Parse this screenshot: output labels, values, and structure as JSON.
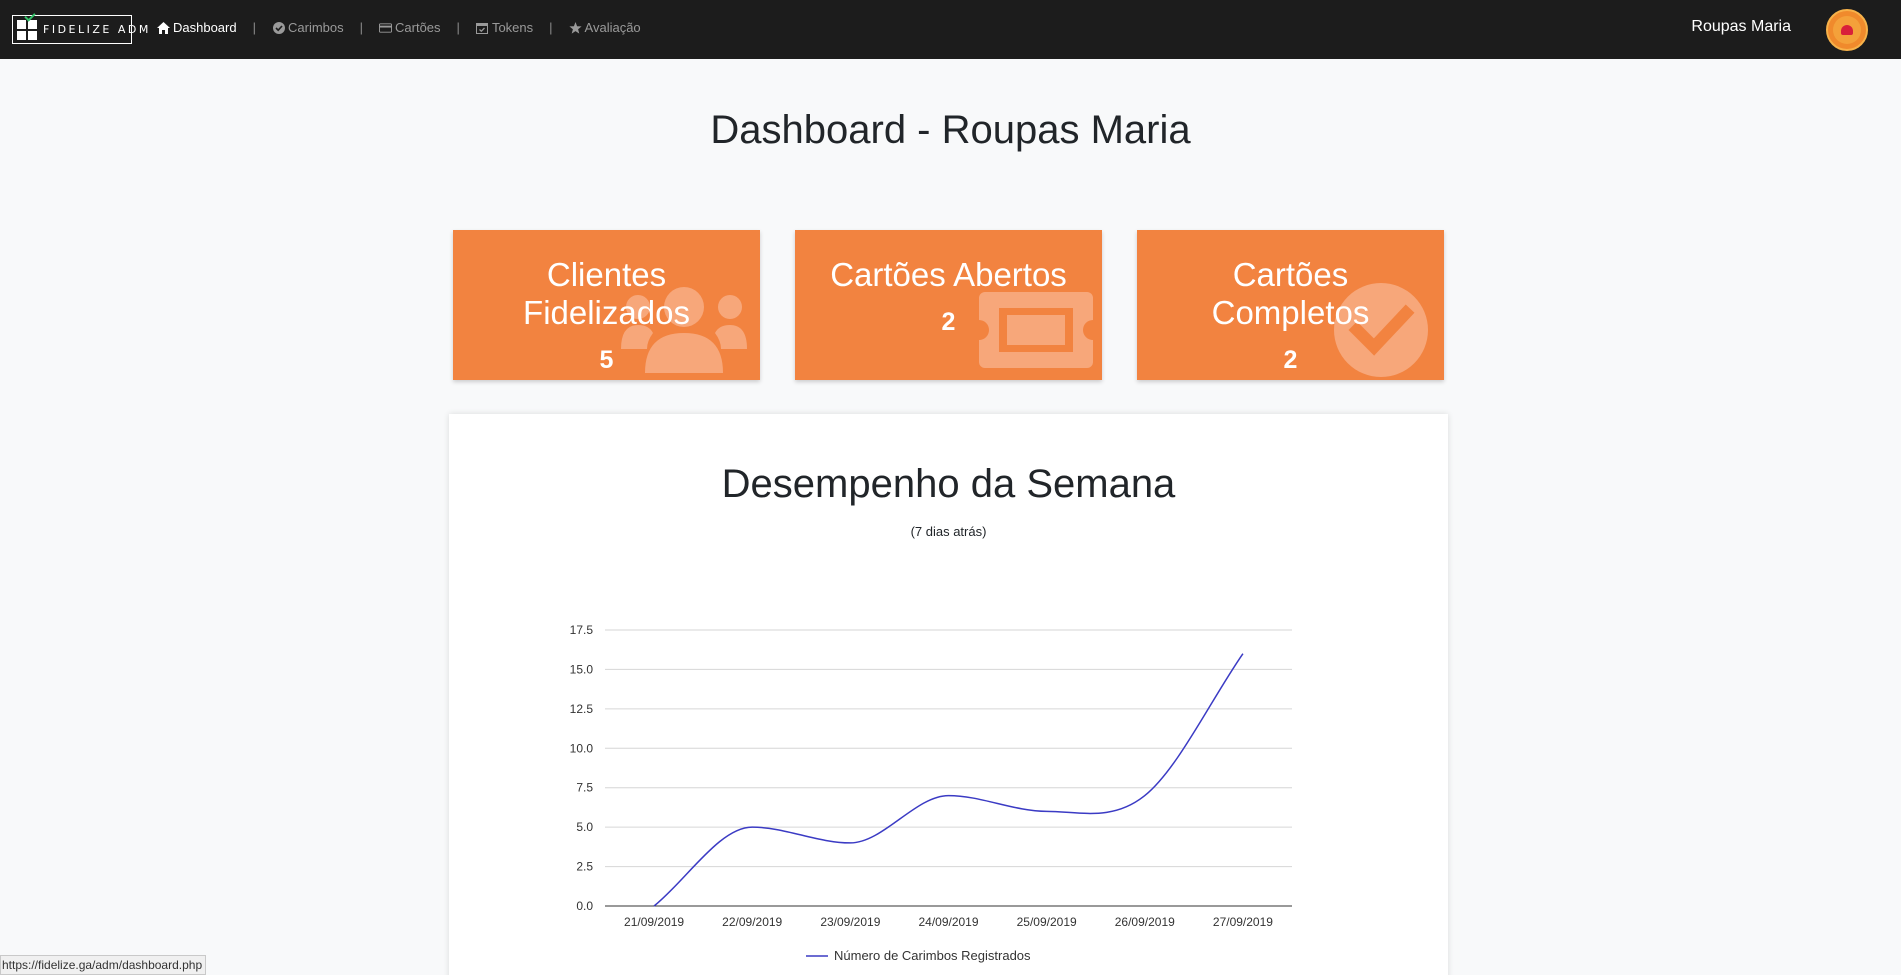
{
  "brand": {
    "logo_text": "FIDELIZE ADM",
    "logo_icon": "fidelize-logo-icon"
  },
  "nav": {
    "items": [
      {
        "label": "Dashboard",
        "icon": "home-icon",
        "active": true
      },
      {
        "label": "Carimbos",
        "icon": "check-circle-icon",
        "active": false
      },
      {
        "label": "Cartões",
        "icon": "card-icon",
        "active": false
      },
      {
        "label": "Tokens",
        "icon": "calendar-check-icon",
        "active": false
      },
      {
        "label": "Avaliação",
        "icon": "star-icon",
        "active": false
      }
    ],
    "separator": "|"
  },
  "user": {
    "name": "Roupas Maria",
    "avatar_icon": "store-logo-avatar"
  },
  "page": {
    "title": "Dashboard - Roupas Maria"
  },
  "cards": [
    {
      "title_line1": "Clientes",
      "title_line2": "Fidelizados",
      "value": "5",
      "icon": "users-icon"
    },
    {
      "title_line1": "Cartões Abertos",
      "title_line2": "",
      "value": "2",
      "icon": "ticket-icon"
    },
    {
      "title_line1": "Cartões",
      "title_line2": "Completos",
      "value": "2",
      "icon": "check-circle-icon"
    }
  ],
  "chart_section": {
    "title": "Desempenho da Semana",
    "subtitle": "(7 dias atrás)"
  },
  "chart_data": {
    "type": "line",
    "categories": [
      "21/09/2019",
      "22/09/2019",
      "23/09/2019",
      "24/09/2019",
      "25/09/2019",
      "26/09/2019",
      "27/09/2019"
    ],
    "series": [
      {
        "name": "Número de Carimbos Registrados",
        "values": [
          0,
          5,
          4,
          7,
          6,
          7,
          16
        ],
        "color": "#3b3bc4"
      }
    ],
    "ylim": [
      0,
      17.5
    ],
    "yticks": [
      "0.0",
      "2.5",
      "5.0",
      "7.5",
      "10.0",
      "12.5",
      "15.0",
      "17.5"
    ],
    "grid": true,
    "legend": "bottom",
    "curve": "smooth"
  },
  "status_bar": {
    "url": "https://fidelize.ga/adm/dashboard.php"
  },
  "colors": {
    "navbar": "#1c1c1c",
    "card": "#f28340",
    "line": "#3b3bc4"
  }
}
